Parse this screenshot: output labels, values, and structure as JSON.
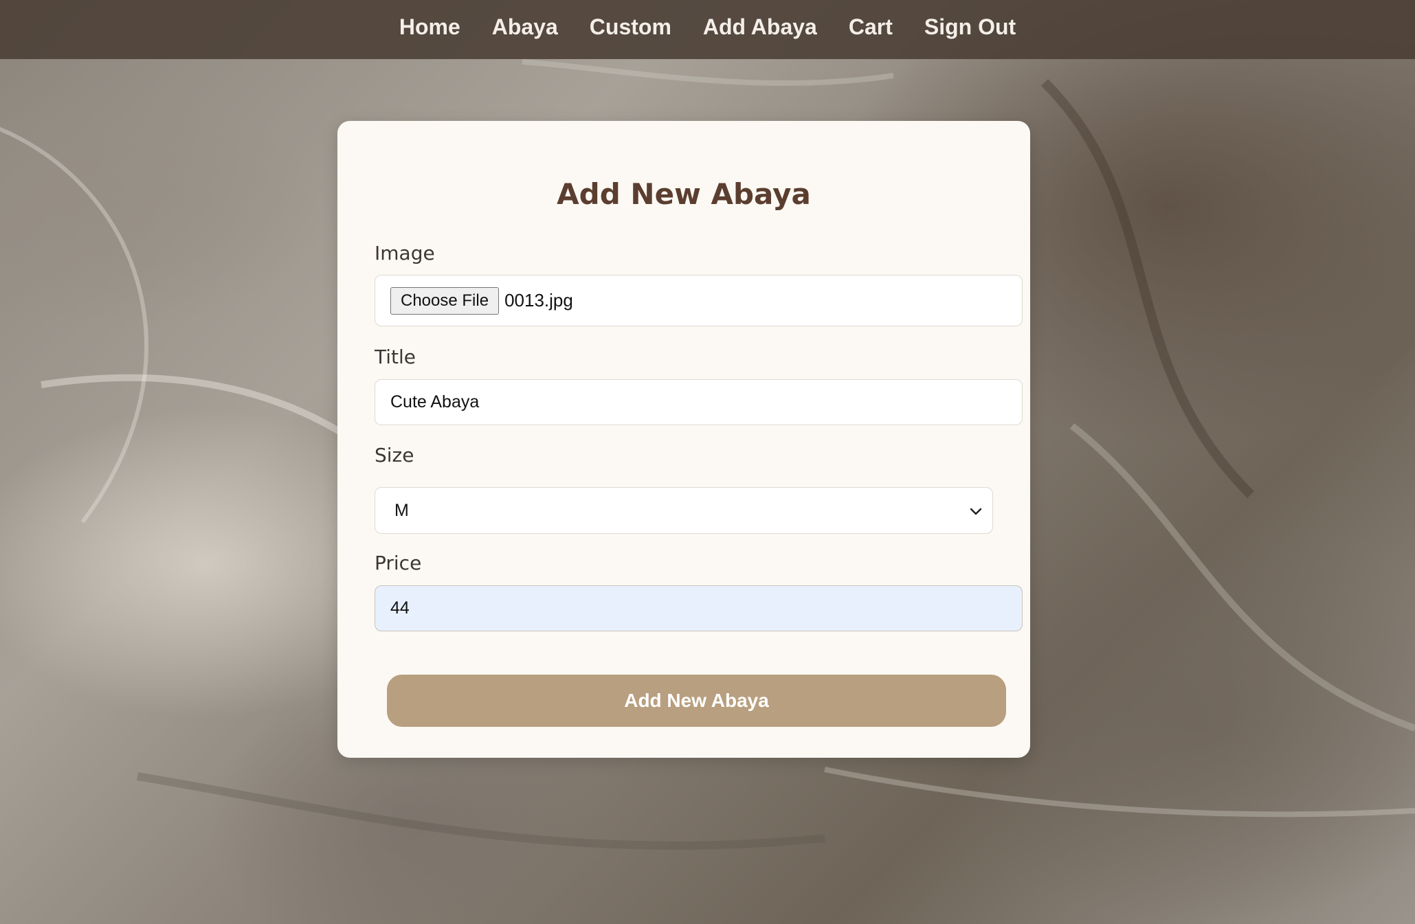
{
  "nav": {
    "items": [
      {
        "label": "Home"
      },
      {
        "label": "Abaya"
      },
      {
        "label": "Custom"
      },
      {
        "label": "Add Abaya"
      },
      {
        "label": "Cart"
      },
      {
        "label": "Sign Out"
      }
    ]
  },
  "form": {
    "title": "Add New Abaya",
    "image": {
      "label": "Image",
      "button_label": "Choose File",
      "file_name": "0013.jpg"
    },
    "title_field": {
      "label": "Title",
      "value": "Cute Abaya"
    },
    "size": {
      "label": "Size",
      "selected": "M"
    },
    "price": {
      "label": "Price",
      "value": "44"
    },
    "submit_label": "Add New Abaya"
  },
  "colors": {
    "nav_background": "#4a3e34",
    "card_background": "#fcf9f4",
    "heading": "#5b3e2f",
    "button": "#b89f7f",
    "autofill": "#e8f0fe"
  }
}
